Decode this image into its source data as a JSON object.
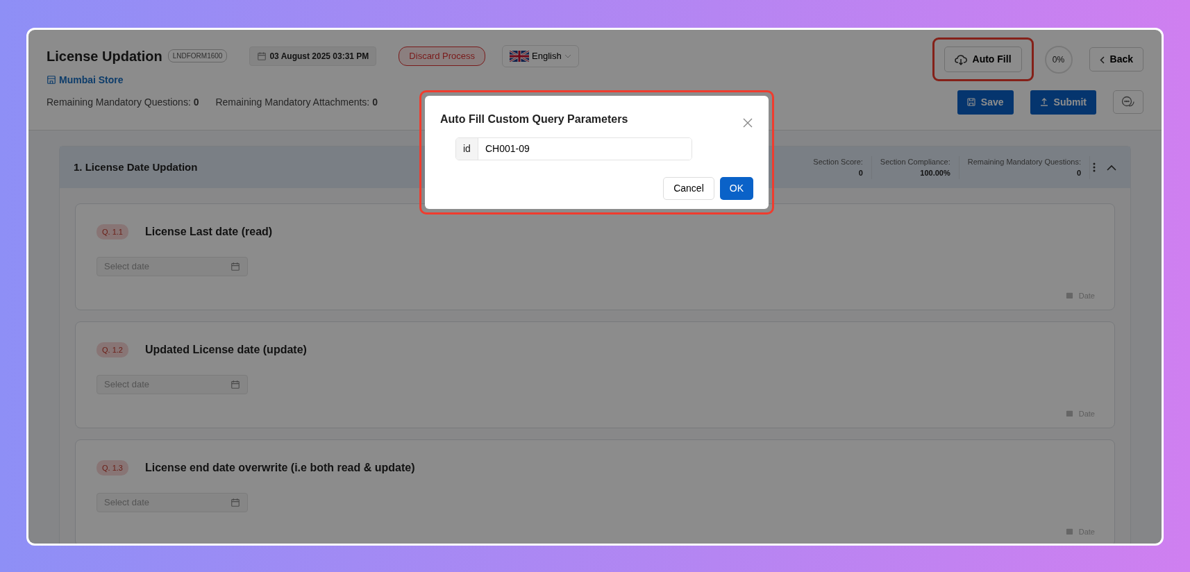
{
  "header": {
    "title": "License Updation",
    "form_code": "LNDFORM1600",
    "datetime": "03 August 2025 03:31 PM",
    "discard_button": "Discard Process",
    "language": "English",
    "store": "Mumbai Store",
    "counters": [
      {
        "label": "Remaining Mandatory Questions:",
        "value": "0"
      },
      {
        "label": "Remaining Mandatory Attachments:",
        "value": "0"
      }
    ],
    "autofill_button": {
      "label": "Auto Fill",
      "highlighted": true
    },
    "progress": "0%",
    "back_button": "Back",
    "save_button": "Save",
    "submit_button": "Submit"
  },
  "section": {
    "title": "1. License Date Updation",
    "expanded": true,
    "stats": [
      {
        "label": "Section Score:",
        "value": "0"
      },
      {
        "label": "Section Compliance:",
        "value": "100.00%"
      },
      {
        "label": "Remaining Mandatory Questions:",
        "value": "0"
      }
    ]
  },
  "questions": [
    {
      "number": "Q. 1.1",
      "title": "License Last date (read)",
      "placeholder": "Select date",
      "type": "Date"
    },
    {
      "number": "Q. 1.2",
      "title": "Updated License date (update)",
      "placeholder": "Select date",
      "type": "Date"
    },
    {
      "number": "Q. 1.3",
      "title": "License end date overwrite (i.e both read & update)",
      "placeholder": "Select date",
      "type": "Date"
    }
  ],
  "modal": {
    "title": "Auto Fill Custom Query Parameters",
    "highlighted": true,
    "params": [
      {
        "label": "id",
        "value": "CH001-09"
      }
    ],
    "cancel_button": "Cancel",
    "ok_button": "OK"
  }
}
